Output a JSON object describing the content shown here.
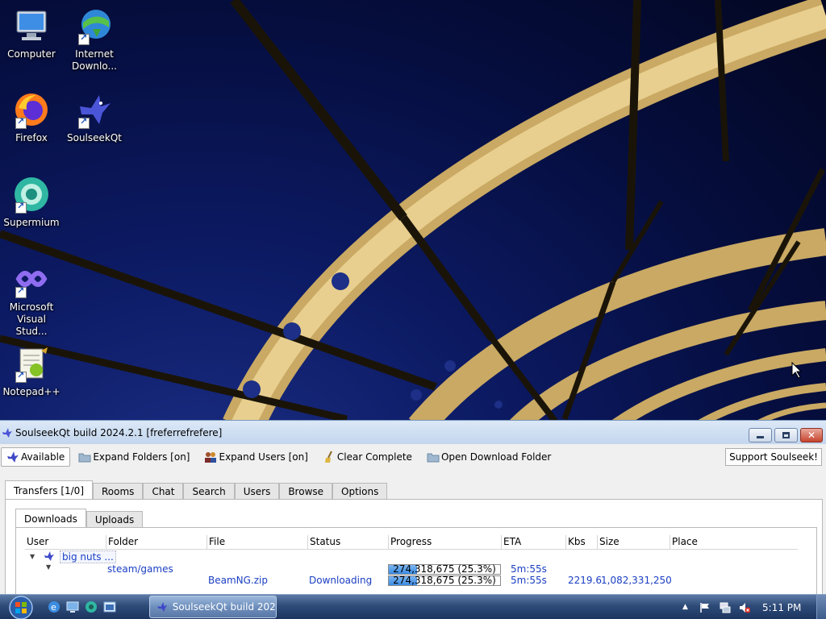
{
  "desktop": {
    "icons": [
      {
        "label": "Computer"
      },
      {
        "label": "Internet\nDownlo..."
      },
      {
        "label": "Firefox"
      },
      {
        "label": "SoulseekQt"
      },
      {
        "label": "Supermium"
      },
      {
        "label": "Microsoft\nVisual Stud..."
      },
      {
        "label": "Notepad++"
      }
    ]
  },
  "window": {
    "title": "SoulseekQt build 2024.2.1 [freferrefrefere]",
    "toolbar": {
      "available": "Available",
      "expand_folders": "Expand Folders [on]",
      "expand_users": "Expand Users [on]",
      "clear_complete": "Clear Complete",
      "open_download_folder": "Open Download Folder",
      "support": "Support Soulseek!"
    },
    "main_tabs": [
      "Transfers [1/0]",
      "Rooms",
      "Chat",
      "Search",
      "Users",
      "Browse",
      "Options"
    ],
    "sub_tabs": [
      "Downloads",
      "Uploads"
    ],
    "columns": [
      "User",
      "Folder",
      "File",
      "Status",
      "Progress",
      "ETA",
      "Kbs",
      "Size",
      "Place"
    ],
    "rows": {
      "user": {
        "name": "big nuts ..."
      },
      "folder": {
        "name": "steam/games",
        "progress": "274,318,675 (25.3%)",
        "progress_fraction": 0.253,
        "eta": "5m:55s"
      },
      "file": {
        "name": "BeamNG.zip",
        "status": "Downloading",
        "progress": "274,318,675 (25.3%)",
        "progress_fraction": 0.253,
        "eta": "5m:55s",
        "kbs": "2219.6",
        "size": "1,082,331,250"
      }
    }
  },
  "taskbar": {
    "task_button": "SoulseekQt build 202...",
    "clock": "5:11 PM"
  },
  "colors": {
    "accent": "#3a8be3",
    "link": "#1a3ec2",
    "taskbar": "#2e4b78"
  }
}
